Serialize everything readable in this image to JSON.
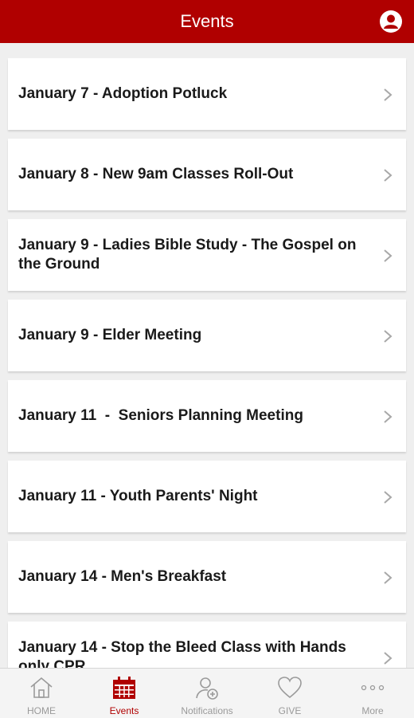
{
  "header": {
    "title": "Events"
  },
  "events": [
    {
      "label": "January 7 - Adoption Potluck"
    },
    {
      "label": "January 8 - New 9am Classes Roll-Out"
    },
    {
      "label": "January 9 - Ladies Bible Study - The Gospel on the Ground"
    },
    {
      "label": "January 9 - Elder Meeting"
    },
    {
      "label": "January 11  -  Seniors Planning Meeting"
    },
    {
      "label": "January 11 - Youth Parents' Night"
    },
    {
      "label": "January 14 - Men's Breakfast"
    },
    {
      "label": "January 14 - Stop the Bleed Class with Hands only CPR"
    }
  ],
  "tabs": [
    {
      "label": "HOME",
      "icon": "home-icon"
    },
    {
      "label": "Events",
      "icon": "calendar-icon",
      "active": true
    },
    {
      "label": "Notifications",
      "icon": "notifications-icon"
    },
    {
      "label": "GIVE",
      "icon": "heart-icon"
    },
    {
      "label": "More",
      "icon": "more-icon"
    }
  ],
  "colors": {
    "brand": "#b00000",
    "background": "#efefef",
    "tab_inactive": "#9a9a9a"
  }
}
